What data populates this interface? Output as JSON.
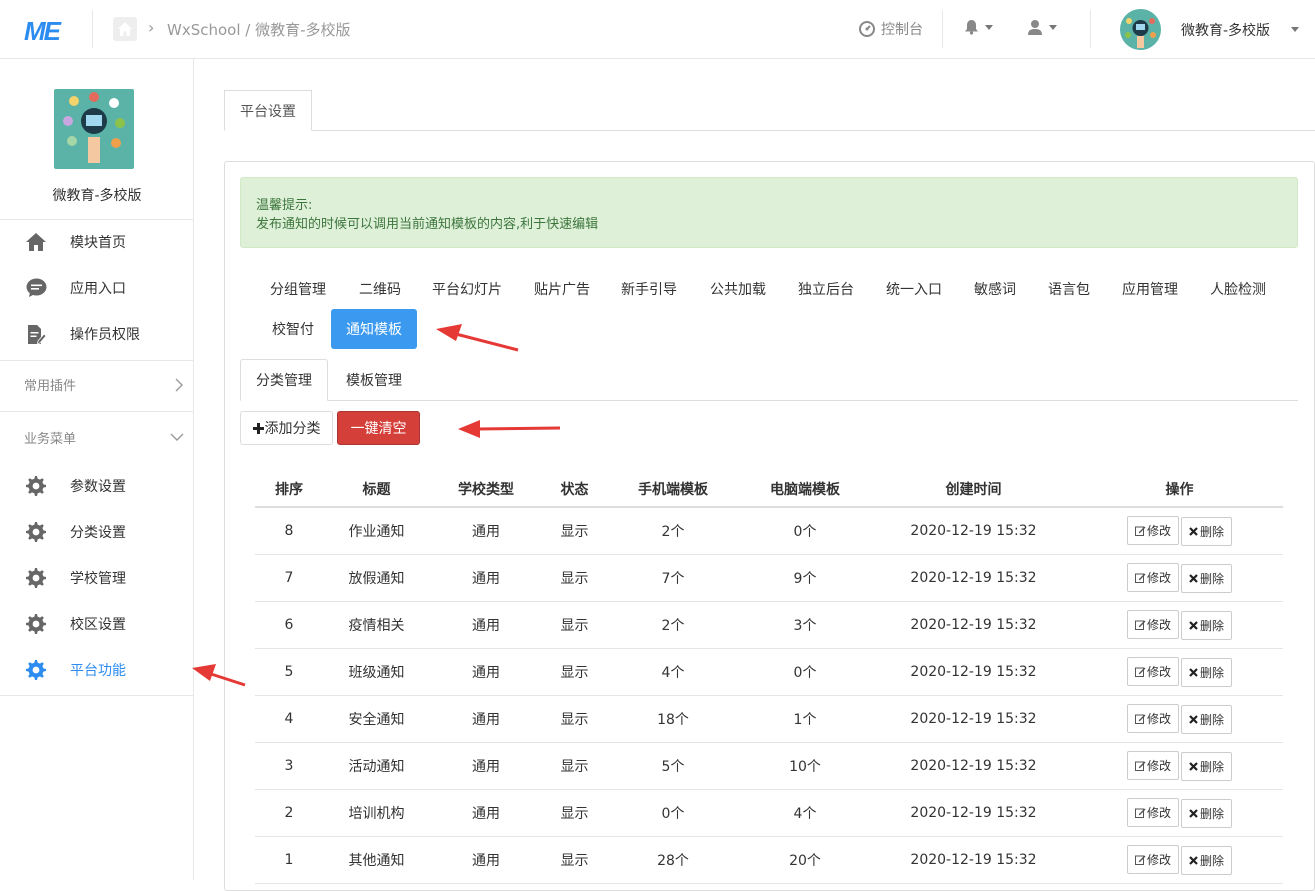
{
  "topbar": {
    "logo": "ME",
    "breadcrumb": "WxSchool / 微教育-多校版",
    "console_label": "控制台",
    "user_name": "微教育-多校版"
  },
  "sidebar": {
    "title": "微教育-多校版",
    "top_items": [
      {
        "label": "模块首页",
        "icon": "home-icon"
      },
      {
        "label": "应用入口",
        "icon": "chat-icon"
      },
      {
        "label": "操作员权限",
        "icon": "document-edit-icon"
      }
    ],
    "group_common": "常用插件",
    "group_business": "业务菜单",
    "business_items": [
      {
        "label": "参数设置",
        "icon": "gear-icon"
      },
      {
        "label": "分类设置",
        "icon": "gear-icon"
      },
      {
        "label": "学校管理",
        "icon": "gear-icon"
      },
      {
        "label": "校区设置",
        "icon": "gear-icon"
      },
      {
        "label": "平台功能",
        "icon": "gear-icon",
        "active": true
      }
    ]
  },
  "main": {
    "page_tab": "平台设置",
    "alert_title": "温馨提示:",
    "alert_text": "发布通知的时候可以调用当前通知模板的内容,利于快速编辑",
    "nav": [
      "分组管理",
      "二维码",
      "平台幻灯片",
      "贴片广告",
      "新手引导",
      "公共加载",
      "独立后台",
      "统一入口",
      "敏感词",
      "语言包",
      "应用管理",
      "人脸检测",
      "校智付",
      "通知模板"
    ],
    "nav_active": "通知模板",
    "sub_tabs": [
      "分类管理",
      "模板管理"
    ],
    "add_button": "添加分类",
    "clear_button": "一键清空",
    "table": {
      "headers": [
        "排序",
        "标题",
        "学校类型",
        "状态",
        "手机端模板",
        "电脑端模板",
        "创建时间",
        "操作"
      ],
      "rows": [
        [
          "8",
          "作业通知",
          "通用",
          "显示",
          "2个",
          "0个",
          "2020-12-19 15:32"
        ],
        [
          "7",
          "放假通知",
          "通用",
          "显示",
          "7个",
          "9个",
          "2020-12-19 15:32"
        ],
        [
          "6",
          "疫情相关",
          "通用",
          "显示",
          "2个",
          "3个",
          "2020-12-19 15:32"
        ],
        [
          "5",
          "班级通知",
          "通用",
          "显示",
          "4个",
          "0个",
          "2020-12-19 15:32"
        ],
        [
          "4",
          "安全通知",
          "通用",
          "显示",
          "18个",
          "1个",
          "2020-12-19 15:32"
        ],
        [
          "3",
          "活动通知",
          "通用",
          "显示",
          "5个",
          "10个",
          "2020-12-19 15:32"
        ],
        [
          "2",
          "培训机构",
          "通用",
          "显示",
          "0个",
          "4个",
          "2020-12-19 15:32"
        ],
        [
          "1",
          "其他通知",
          "通用",
          "显示",
          "28个",
          "20个",
          "2020-12-19 15:32"
        ]
      ],
      "edit_label": "修改",
      "delete_label": "删除"
    }
  },
  "colors": {
    "accent": "#3b9aef",
    "danger": "#d43f3a",
    "alert_bg": "#dff0d8",
    "arrow": "#e53935"
  }
}
